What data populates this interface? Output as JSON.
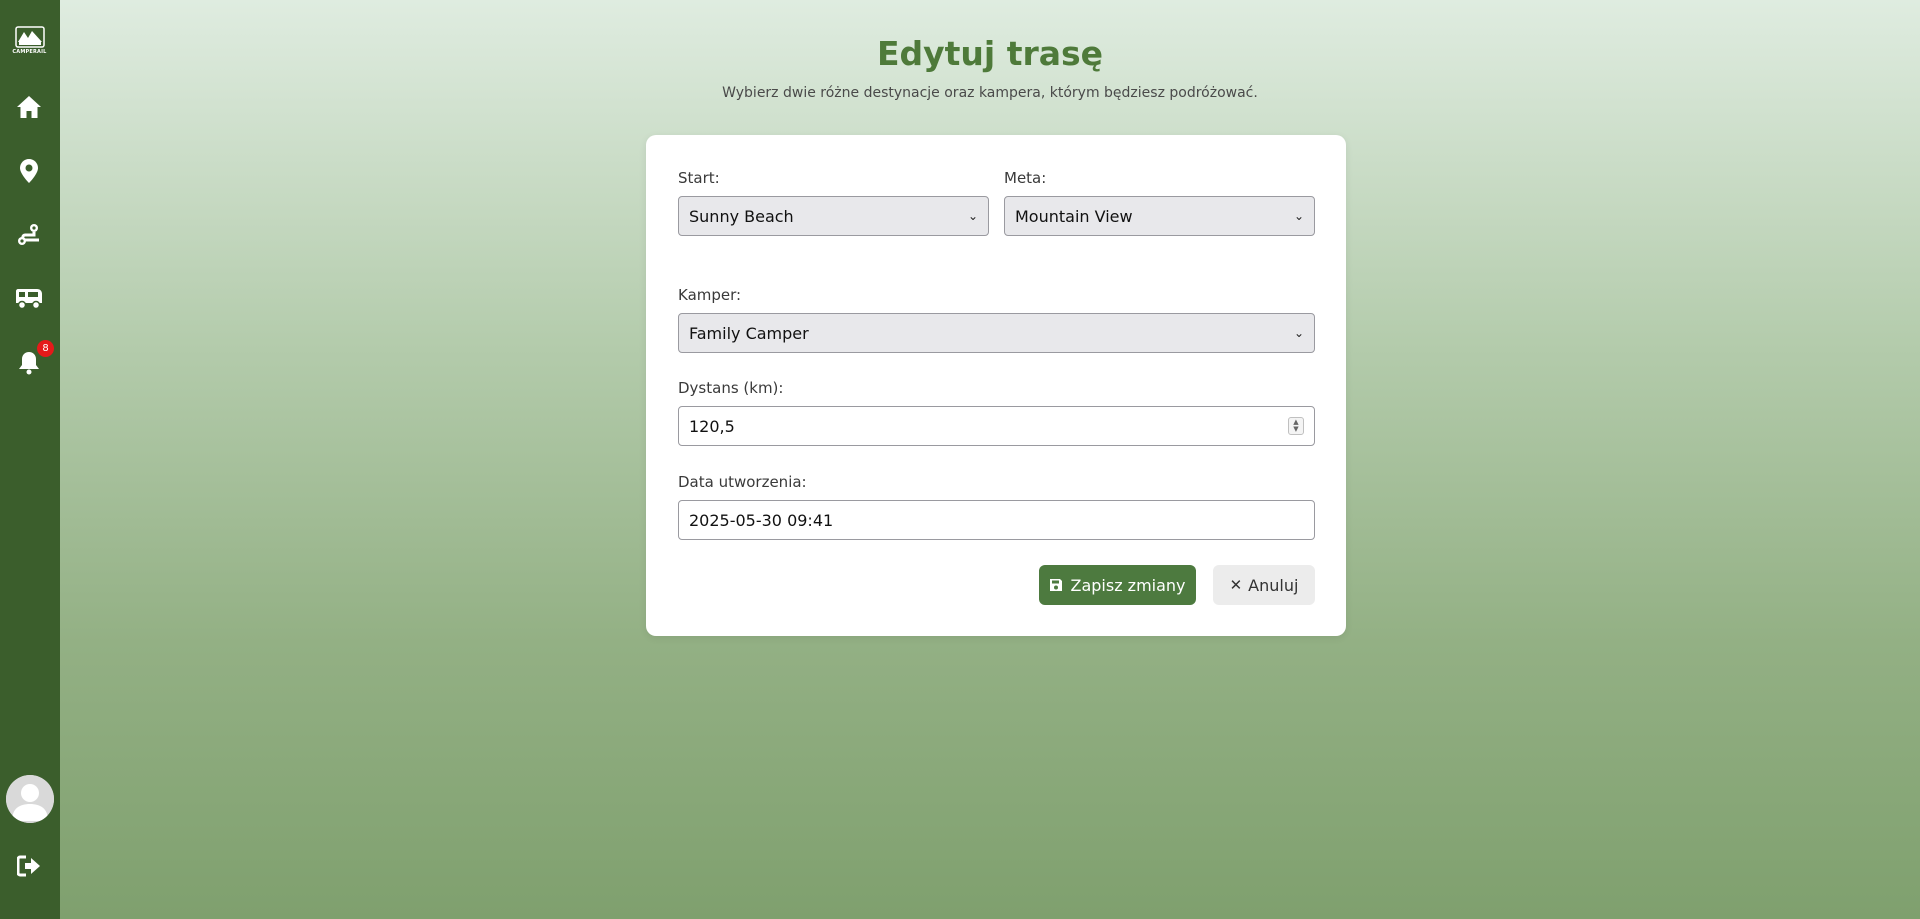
{
  "sidebar": {
    "logo_text": "CAMPERAIL",
    "items": [
      {
        "icon": "home-icon"
      },
      {
        "icon": "location-pin-icon"
      },
      {
        "icon": "route-icon"
      },
      {
        "icon": "camper-van-icon"
      },
      {
        "icon": "bell-icon"
      }
    ],
    "notification_count": "8",
    "logout_icon": "logout-icon"
  },
  "page": {
    "title": "Edytuj trasę",
    "subtitle": "Wybierz dwie różne destynacje oraz kampera, którym będziesz podróżować."
  },
  "form": {
    "start_label": "Start:",
    "start_value": "Sunny Beach",
    "meta_label": "Meta:",
    "meta_value": "Mountain View",
    "kamper_label": "Kamper:",
    "kamper_value": "Family Camper",
    "distance_label": "Dystans (km):",
    "distance_value": "120,5",
    "date_label": "Data utworzenia:",
    "date_value": "2025-05-30 09:41",
    "save_label": "Zapisz zmiany",
    "cancel_label": "Anuluj"
  },
  "colors": {
    "sidebar": "#3b5e2c",
    "accent": "#4e7a3a",
    "save_button": "#4d7a3f",
    "badge": "#e51a1a"
  }
}
